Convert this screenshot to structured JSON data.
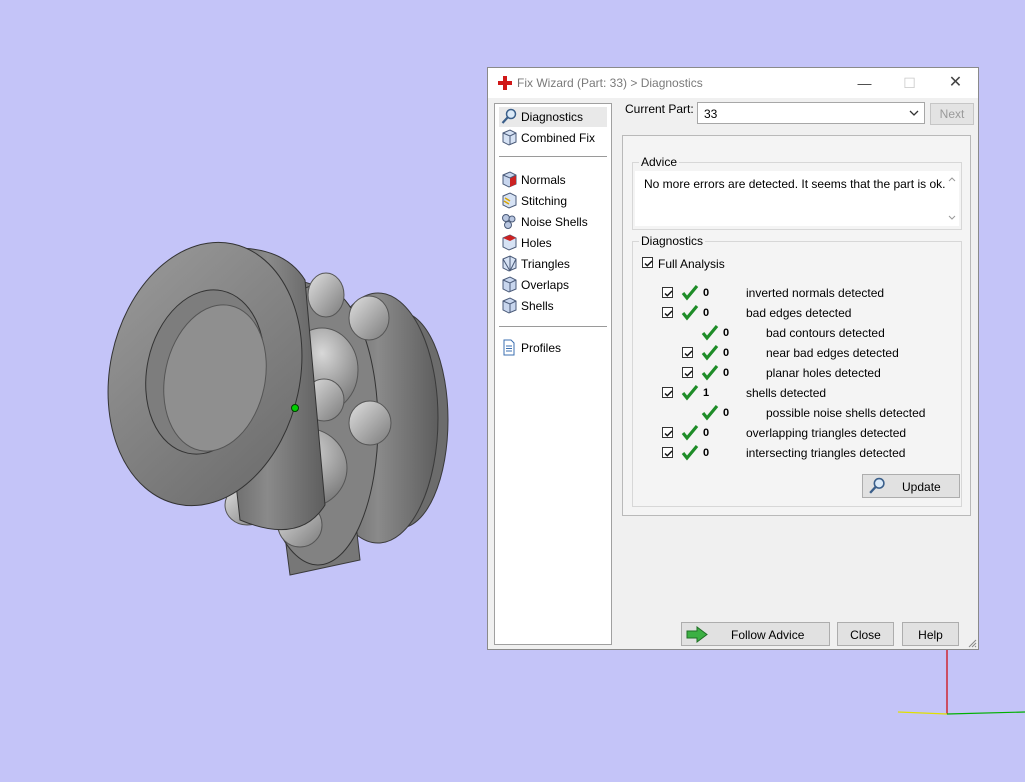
{
  "window": {
    "title": "Fix Wizard (Part: 33) > Diagnostics",
    "minimize_glyph": "—",
    "maximize_glyph": "☐",
    "close_glyph": "✕"
  },
  "sidebar": {
    "items": [
      {
        "label": "Diagnostics",
        "icon": "magnifier-icon",
        "selected": true
      },
      {
        "label": "Combined Fix",
        "icon": "cube-icon"
      },
      {
        "label": "Normals",
        "icon": "normals-cube-icon"
      },
      {
        "label": "Stitching",
        "icon": "stitching-cube-icon"
      },
      {
        "label": "Noise Shells",
        "icon": "noise-shells-icon"
      },
      {
        "label": "Holes",
        "icon": "holes-cube-icon"
      },
      {
        "label": "Triangles",
        "icon": "triangles-cube-icon"
      },
      {
        "label": "Overlaps",
        "icon": "overlaps-cube-icon"
      },
      {
        "label": "Shells",
        "icon": "shells-cube-icon"
      },
      {
        "label": "Profiles",
        "icon": "document-icon"
      }
    ]
  },
  "current_part": {
    "label": "Current Part:",
    "value": "33"
  },
  "next_label": "Next",
  "advice": {
    "title": "Advice",
    "text": "No more errors are detected. It seems that the part is ok."
  },
  "diagnostics": {
    "title": "Diagnostics",
    "full_analysis_label": "Full Analysis",
    "full_analysis_checked": true,
    "rows": [
      {
        "count": "0",
        "label": "inverted normals detected",
        "has_checkbox": true,
        "checked": true,
        "indent": 0
      },
      {
        "count": "0",
        "label": "bad edges detected",
        "has_checkbox": true,
        "checked": true,
        "indent": 0
      },
      {
        "count": "0",
        "label": "bad contours detected",
        "has_checkbox": false,
        "indent": 1
      },
      {
        "count": "0",
        "label": "near bad edges detected",
        "has_checkbox": true,
        "checked": true,
        "indent": 1
      },
      {
        "count": "0",
        "label": "planar holes detected",
        "has_checkbox": true,
        "checked": true,
        "indent": 1
      },
      {
        "count": "1",
        "label": "shells detected",
        "has_checkbox": true,
        "checked": true,
        "indent": 0
      },
      {
        "count": "0",
        "label": "possible noise shells detected",
        "has_checkbox": false,
        "indent": 1
      },
      {
        "count": "0",
        "label": "overlapping triangles detected",
        "has_checkbox": true,
        "checked": true,
        "indent": 0
      },
      {
        "count": "0",
        "label": "intersecting triangles detected",
        "has_checkbox": true,
        "checked": true,
        "indent": 0
      }
    ],
    "update_label": "Update"
  },
  "footer": {
    "follow_advice_label": "Follow Advice",
    "close_label": "Close",
    "help_label": "Help"
  },
  "colors": {
    "background": "#c4c4f8",
    "check_green": "#1e8c28",
    "axis_red": "#d00000",
    "axis_green": "#00b000",
    "axis_yellow": "#e0e000"
  }
}
